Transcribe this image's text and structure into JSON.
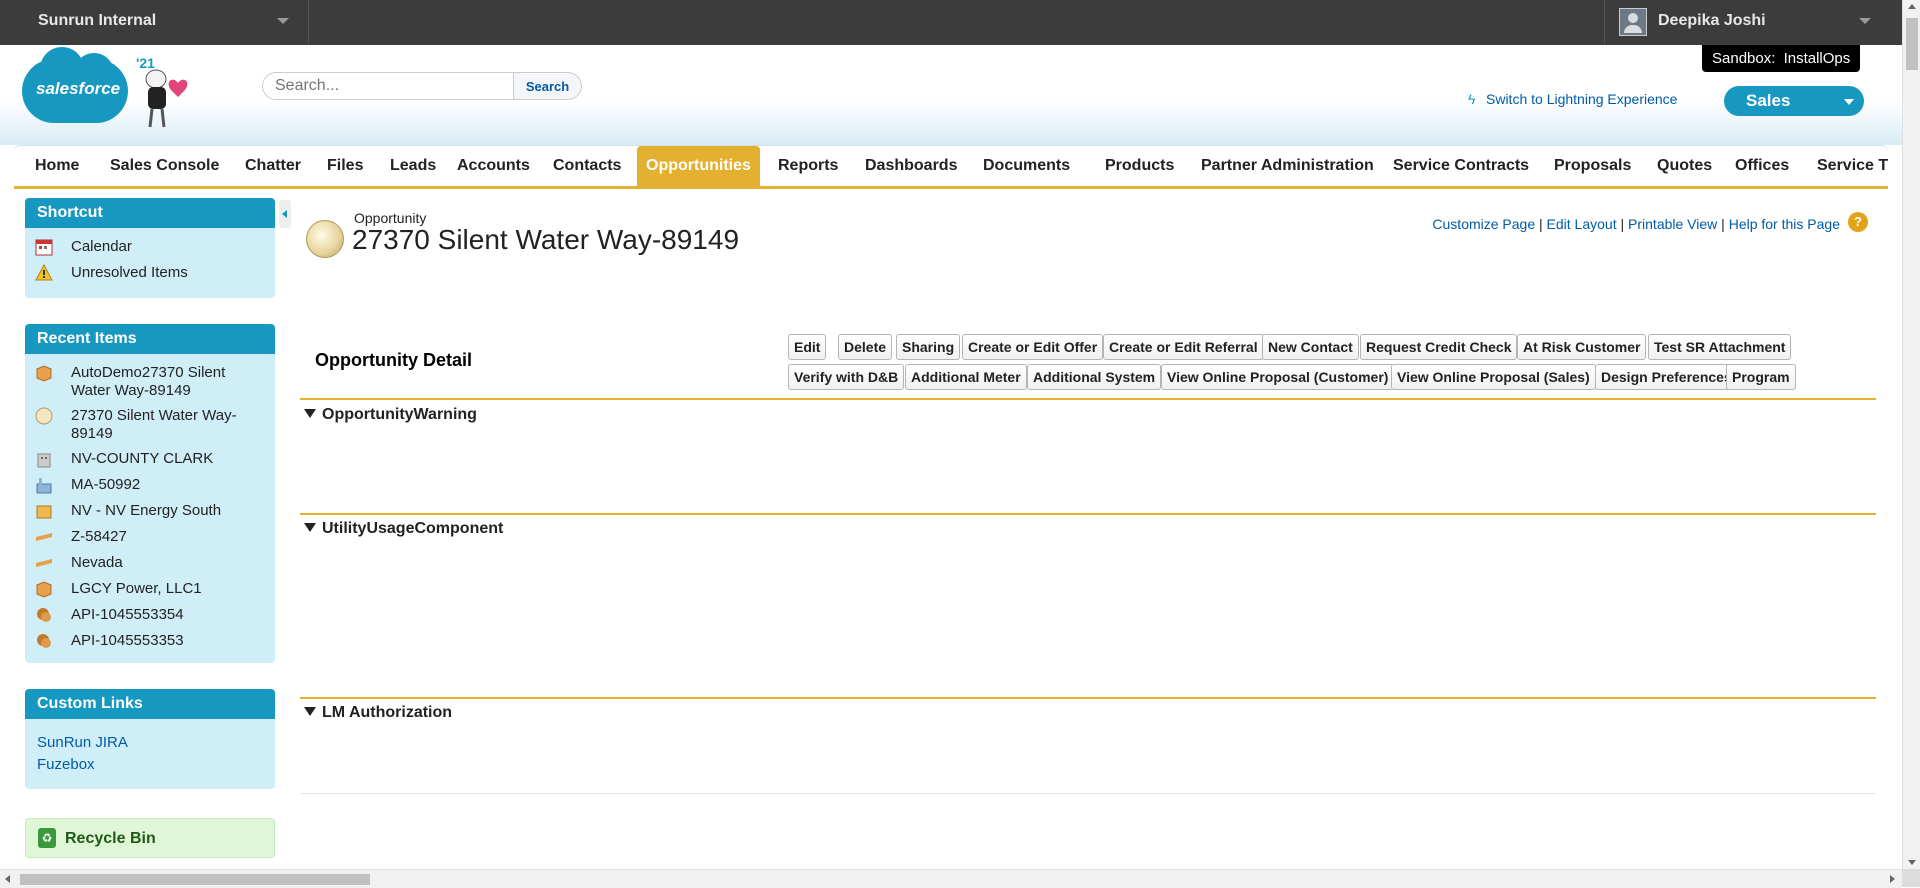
{
  "topbar": {
    "org_name": "Sunrun Internal",
    "user_name": "Deepika Joshi"
  },
  "header": {
    "logo_text": "salesforce",
    "logo_year": "'21",
    "search_placeholder": "Search...",
    "search_button": "Search",
    "sandbox_label": "Sandbox:",
    "sandbox_name": "InstallOps",
    "lightning_link": "Switch to Lightning Experience",
    "app_menu": "Sales"
  },
  "tabs": [
    "Home",
    "Sales Console",
    "Chatter",
    "Files",
    "Leads",
    "Accounts",
    "Contacts",
    "Opportunities",
    "Reports",
    "Dashboards",
    "Documents",
    "Products",
    "Partner Administration",
    "Service Contracts",
    "Proposals",
    "Quotes",
    "Offices",
    "Service Tr"
  ],
  "active_tab": "Opportunities",
  "sidebar": {
    "shortcut": {
      "title": "Shortcut",
      "items": [
        "Calendar",
        "Unresolved Items"
      ]
    },
    "recent": {
      "title": "Recent Items",
      "items": [
        "AutoDemo27370 Silent Water Way-89149",
        "27370 Silent Water Way-89149",
        "NV-COUNTY CLARK",
        "MA-50992",
        "NV - NV Energy South",
        "Z-58427",
        "Nevada",
        "LGCY Power, LLC1",
        "API-1045553354",
        "API-1045553353"
      ]
    },
    "custom_links": {
      "title": "Custom Links",
      "items": [
        "SunRun JIRA",
        "Fuzebox"
      ]
    },
    "recycle_bin": "Recycle Bin"
  },
  "main": {
    "record_type": "Opportunity",
    "record_title": "27370 Silent Water Way-89149",
    "page_links": [
      "Customize Page",
      "Edit Layout",
      "Printable View",
      "Help for this Page"
    ],
    "detail_title": "Opportunity Detail",
    "buttons_row1": [
      "Edit",
      "Delete",
      "Sharing",
      "Create or Edit Offer",
      "Create or Edit Referral",
      "New Contact",
      "Request Credit Check",
      "At Risk Customer",
      "Test SR Attachment"
    ],
    "buttons_row2": [
      "Verify with D&B",
      "Additional Meter",
      "Additional System",
      "View Online Proposal (Customer)",
      "View Online Proposal (Sales)",
      "Design Preferences",
      "Program"
    ],
    "sections": [
      "OpportunityWarning",
      "UtilityUsageComponent",
      "LM Authorization"
    ]
  },
  "colors": {
    "brand_blue": "#1798c1",
    "tab_gold": "#e3b12f",
    "link_blue": "#015ba7",
    "topbar": "#3c3c3c"
  }
}
